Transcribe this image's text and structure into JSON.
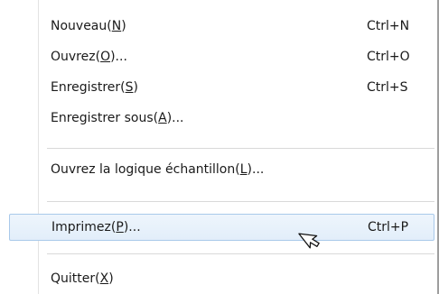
{
  "menu": {
    "items": [
      {
        "pre": "Nouveau(",
        "key": "N",
        "post": ")",
        "shortcut": "Ctrl+N"
      },
      {
        "pre": "Ouvrez(",
        "key": "O",
        "post": ")...",
        "shortcut": "Ctrl+O"
      },
      {
        "pre": "Enregistrer(",
        "key": "S",
        "post": ")",
        "shortcut": "Ctrl+S"
      },
      {
        "pre": "Enregistrer sous(",
        "key": "A",
        "post": ")...",
        "shortcut": ""
      },
      {
        "pre": "Ouvrez la logique échantillon(",
        "key": "L",
        "post": ")...",
        "shortcut": ""
      },
      {
        "pre": "Imprimez(",
        "key": "P",
        "post": ")...",
        "shortcut": "Ctrl+P"
      },
      {
        "pre": "Quitter(",
        "key": "X",
        "post": ")",
        "shortcut": ""
      }
    ]
  },
  "cursor": {
    "icon": "arrow-cursor-icon"
  },
  "colors": {
    "hover_bg": "#e8f1fb",
    "hover_border": "#a9c9ea",
    "separator": "#d9d9d9"
  }
}
